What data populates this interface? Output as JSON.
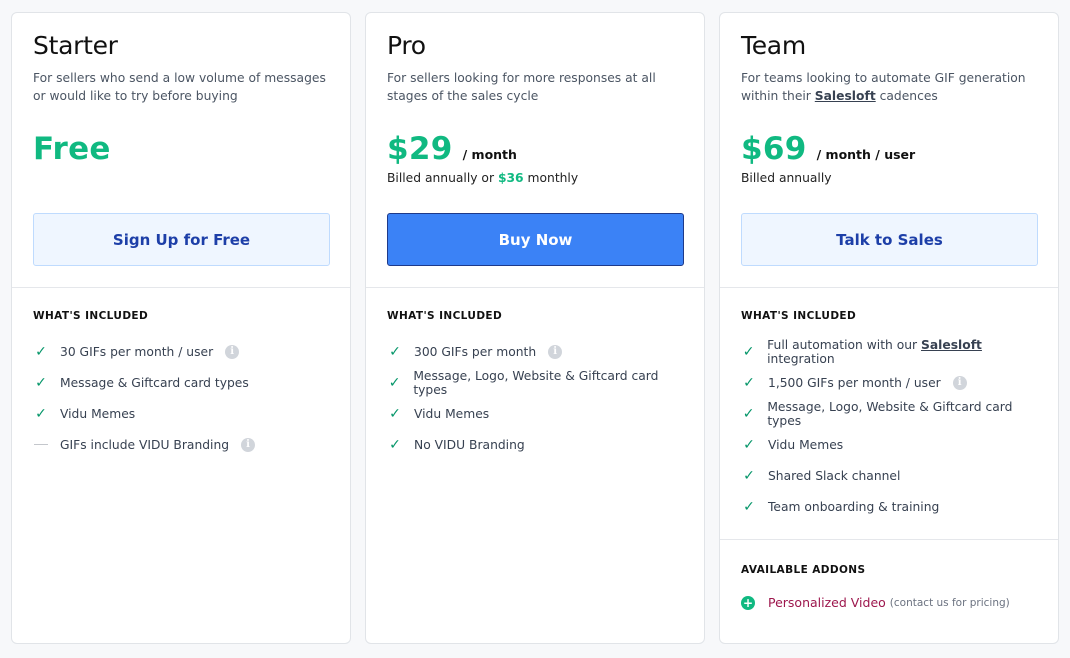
{
  "plans": [
    {
      "name": "Starter",
      "description": "For sellers who send a low volume of messages or would like to try before buying",
      "price": "Free",
      "per": "",
      "billing_prefix": "",
      "billing_highlight": "",
      "billing_suffix": "",
      "cta": "Sign Up for Free",
      "section_title": "WHAT'S INCLUDED",
      "features": [
        {
          "text": "30 GIFs per month / user",
          "included": true,
          "info": true
        },
        {
          "text": "Message & Giftcard card types",
          "included": true,
          "info": false
        },
        {
          "text": "Vidu Memes",
          "included": true,
          "info": false
        },
        {
          "text": "GIFs include VIDU Branding",
          "included": false,
          "info": true
        }
      ]
    },
    {
      "name": "Pro",
      "description": "For sellers looking for more responses at all stages of the sales cycle",
      "price": "$29",
      "per": "/ month",
      "billing_prefix": "Billed annually or ",
      "billing_highlight": "$36",
      "billing_suffix": " monthly",
      "cta": "Buy Now",
      "section_title": "WHAT'S INCLUDED",
      "features": [
        {
          "text": "300 GIFs per month",
          "included": true,
          "info": true
        },
        {
          "text": "Message, Logo, Website & Giftcard card types",
          "included": true,
          "info": false
        },
        {
          "text": "Vidu Memes",
          "included": true,
          "info": false
        },
        {
          "text": "No VIDU Branding",
          "included": true,
          "info": false
        }
      ]
    },
    {
      "name": "Team",
      "description_prefix": "For teams looking to automate GIF generation within their ",
      "description_brand": "Salesloft",
      "description_suffix": " cadences",
      "price": "$69",
      "per": "/ month / user",
      "billing_prefix": "Billed annually",
      "cta": "Talk to Sales",
      "section_title": "WHAT'S INCLUDED",
      "features": [
        {
          "prefix": "Full automation with our ",
          "brand": "Salesloft",
          "suffix": " integration",
          "included": true,
          "info": false
        },
        {
          "text": "1,500 GIFs per month / user",
          "included": true,
          "info": true
        },
        {
          "text": "Message, Logo, Website & Giftcard card types",
          "included": true,
          "info": false
        },
        {
          "text": "Vidu Memes",
          "included": true,
          "info": false
        },
        {
          "text": "Shared Slack channel",
          "included": true,
          "info": false
        },
        {
          "text": "Team onboarding & training",
          "included": true,
          "info": false
        }
      ],
      "addons_title": "AVAILABLE ADDONS",
      "addon_name": "Personalized Video",
      "addon_note": "(contact us for pricing)"
    }
  ],
  "icons": {
    "check": "check-icon",
    "dash": "dash-icon",
    "info": "info-icon",
    "plus": "plus-circle-icon"
  },
  "colors": {
    "price_green": "#10b981",
    "check_green": "#059669",
    "primary_button": "#3b82f6",
    "secondary_button_bg": "#eff6ff",
    "secondary_button_text": "#1d3fa8",
    "addon_text": "#9d174d"
  }
}
